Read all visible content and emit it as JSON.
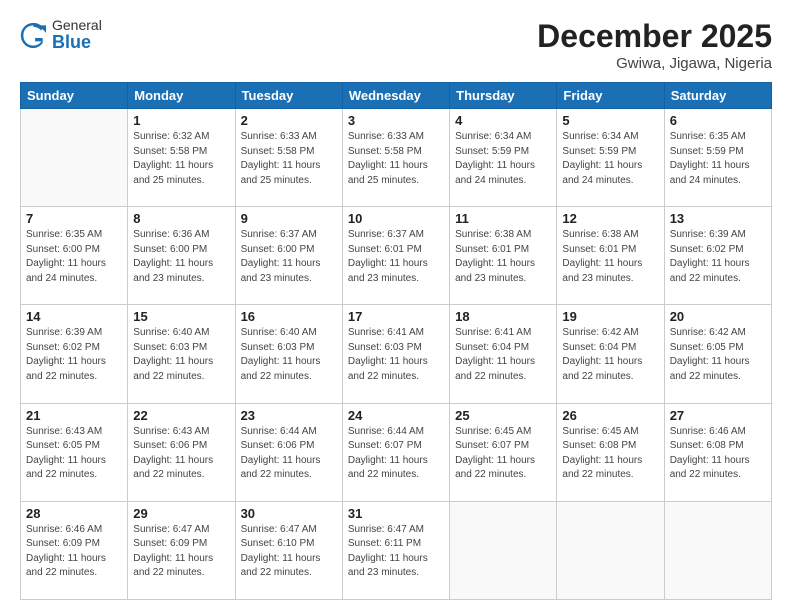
{
  "logo": {
    "general": "General",
    "blue": "Blue"
  },
  "title": "December 2025",
  "subtitle": "Gwiwa, Jigawa, Nigeria",
  "days_of_week": [
    "Sunday",
    "Monday",
    "Tuesday",
    "Wednesday",
    "Thursday",
    "Friday",
    "Saturday"
  ],
  "weeks": [
    [
      {
        "day": "",
        "sunrise": "",
        "sunset": "",
        "daylight": ""
      },
      {
        "day": "1",
        "sunrise": "Sunrise: 6:32 AM",
        "sunset": "Sunset: 5:58 PM",
        "daylight": "Daylight: 11 hours and 25 minutes."
      },
      {
        "day": "2",
        "sunrise": "Sunrise: 6:33 AM",
        "sunset": "Sunset: 5:58 PM",
        "daylight": "Daylight: 11 hours and 25 minutes."
      },
      {
        "day": "3",
        "sunrise": "Sunrise: 6:33 AM",
        "sunset": "Sunset: 5:58 PM",
        "daylight": "Daylight: 11 hours and 25 minutes."
      },
      {
        "day": "4",
        "sunrise": "Sunrise: 6:34 AM",
        "sunset": "Sunset: 5:59 PM",
        "daylight": "Daylight: 11 hours and 24 minutes."
      },
      {
        "day": "5",
        "sunrise": "Sunrise: 6:34 AM",
        "sunset": "Sunset: 5:59 PM",
        "daylight": "Daylight: 11 hours and 24 minutes."
      },
      {
        "day": "6",
        "sunrise": "Sunrise: 6:35 AM",
        "sunset": "Sunset: 5:59 PM",
        "daylight": "Daylight: 11 hours and 24 minutes."
      }
    ],
    [
      {
        "day": "7",
        "sunrise": "Sunrise: 6:35 AM",
        "sunset": "Sunset: 6:00 PM",
        "daylight": "Daylight: 11 hours and 24 minutes."
      },
      {
        "day": "8",
        "sunrise": "Sunrise: 6:36 AM",
        "sunset": "Sunset: 6:00 PM",
        "daylight": "Daylight: 11 hours and 23 minutes."
      },
      {
        "day": "9",
        "sunrise": "Sunrise: 6:37 AM",
        "sunset": "Sunset: 6:00 PM",
        "daylight": "Daylight: 11 hours and 23 minutes."
      },
      {
        "day": "10",
        "sunrise": "Sunrise: 6:37 AM",
        "sunset": "Sunset: 6:01 PM",
        "daylight": "Daylight: 11 hours and 23 minutes."
      },
      {
        "day": "11",
        "sunrise": "Sunrise: 6:38 AM",
        "sunset": "Sunset: 6:01 PM",
        "daylight": "Daylight: 11 hours and 23 minutes."
      },
      {
        "day": "12",
        "sunrise": "Sunrise: 6:38 AM",
        "sunset": "Sunset: 6:01 PM",
        "daylight": "Daylight: 11 hours and 23 minutes."
      },
      {
        "day": "13",
        "sunrise": "Sunrise: 6:39 AM",
        "sunset": "Sunset: 6:02 PM",
        "daylight": "Daylight: 11 hours and 22 minutes."
      }
    ],
    [
      {
        "day": "14",
        "sunrise": "Sunrise: 6:39 AM",
        "sunset": "Sunset: 6:02 PM",
        "daylight": "Daylight: 11 hours and 22 minutes."
      },
      {
        "day": "15",
        "sunrise": "Sunrise: 6:40 AM",
        "sunset": "Sunset: 6:03 PM",
        "daylight": "Daylight: 11 hours and 22 minutes."
      },
      {
        "day": "16",
        "sunrise": "Sunrise: 6:40 AM",
        "sunset": "Sunset: 6:03 PM",
        "daylight": "Daylight: 11 hours and 22 minutes."
      },
      {
        "day": "17",
        "sunrise": "Sunrise: 6:41 AM",
        "sunset": "Sunset: 6:03 PM",
        "daylight": "Daylight: 11 hours and 22 minutes."
      },
      {
        "day": "18",
        "sunrise": "Sunrise: 6:41 AM",
        "sunset": "Sunset: 6:04 PM",
        "daylight": "Daylight: 11 hours and 22 minutes."
      },
      {
        "day": "19",
        "sunrise": "Sunrise: 6:42 AM",
        "sunset": "Sunset: 6:04 PM",
        "daylight": "Daylight: 11 hours and 22 minutes."
      },
      {
        "day": "20",
        "sunrise": "Sunrise: 6:42 AM",
        "sunset": "Sunset: 6:05 PM",
        "daylight": "Daylight: 11 hours and 22 minutes."
      }
    ],
    [
      {
        "day": "21",
        "sunrise": "Sunrise: 6:43 AM",
        "sunset": "Sunset: 6:05 PM",
        "daylight": "Daylight: 11 hours and 22 minutes."
      },
      {
        "day": "22",
        "sunrise": "Sunrise: 6:43 AM",
        "sunset": "Sunset: 6:06 PM",
        "daylight": "Daylight: 11 hours and 22 minutes."
      },
      {
        "day": "23",
        "sunrise": "Sunrise: 6:44 AM",
        "sunset": "Sunset: 6:06 PM",
        "daylight": "Daylight: 11 hours and 22 minutes."
      },
      {
        "day": "24",
        "sunrise": "Sunrise: 6:44 AM",
        "sunset": "Sunset: 6:07 PM",
        "daylight": "Daylight: 11 hours and 22 minutes."
      },
      {
        "day": "25",
        "sunrise": "Sunrise: 6:45 AM",
        "sunset": "Sunset: 6:07 PM",
        "daylight": "Daylight: 11 hours and 22 minutes."
      },
      {
        "day": "26",
        "sunrise": "Sunrise: 6:45 AM",
        "sunset": "Sunset: 6:08 PM",
        "daylight": "Daylight: 11 hours and 22 minutes."
      },
      {
        "day": "27",
        "sunrise": "Sunrise: 6:46 AM",
        "sunset": "Sunset: 6:08 PM",
        "daylight": "Daylight: 11 hours and 22 minutes."
      }
    ],
    [
      {
        "day": "28",
        "sunrise": "Sunrise: 6:46 AM",
        "sunset": "Sunset: 6:09 PM",
        "daylight": "Daylight: 11 hours and 22 minutes."
      },
      {
        "day": "29",
        "sunrise": "Sunrise: 6:47 AM",
        "sunset": "Sunset: 6:09 PM",
        "daylight": "Daylight: 11 hours and 22 minutes."
      },
      {
        "day": "30",
        "sunrise": "Sunrise: 6:47 AM",
        "sunset": "Sunset: 6:10 PM",
        "daylight": "Daylight: 11 hours and 22 minutes."
      },
      {
        "day": "31",
        "sunrise": "Sunrise: 6:47 AM",
        "sunset": "Sunset: 6:11 PM",
        "daylight": "Daylight: 11 hours and 23 minutes."
      },
      {
        "day": "",
        "sunrise": "",
        "sunset": "",
        "daylight": ""
      },
      {
        "day": "",
        "sunrise": "",
        "sunset": "",
        "daylight": ""
      },
      {
        "day": "",
        "sunrise": "",
        "sunset": "",
        "daylight": ""
      }
    ]
  ]
}
